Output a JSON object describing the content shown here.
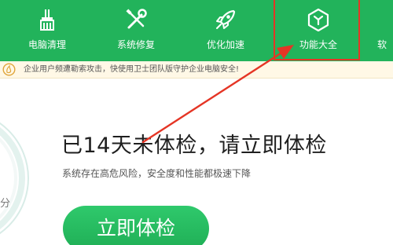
{
  "toolbar": {
    "items": [
      {
        "label": "电脑清理",
        "icon": "broom-icon"
      },
      {
        "label": "系统修复",
        "icon": "wrench-screwdriver-icon"
      },
      {
        "label": "优化加速",
        "icon": "rocket-icon"
      },
      {
        "label": "功能大全",
        "icon": "cube-icon"
      },
      {
        "label": "软",
        "icon": ""
      }
    ],
    "highlighted_item": "功能大全"
  },
  "notice": {
    "text": "企业用户频遭勒索攻击，快使用卫士团队版守护企业电脑安全!",
    "icon": "warning-circle-icon"
  },
  "main": {
    "headline": "已14天未体检，请立即体检",
    "subline": "系统存在高危风险，安全度和性能都极速下降",
    "check_button": "立即体检",
    "side_char": "分"
  },
  "colors": {
    "toolbar_bg": "#22b35b",
    "accent_green": "#28c063",
    "annotation_red": "#e53525",
    "notice_bg": "#fff8e6"
  }
}
